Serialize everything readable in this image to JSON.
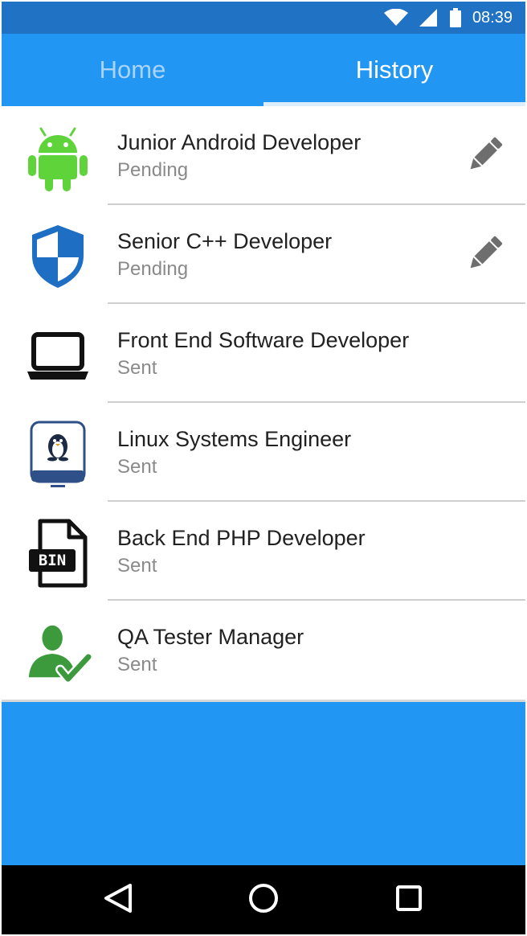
{
  "status_bar": {
    "time": "08:39",
    "icons": [
      "wifi-icon",
      "signal-icon",
      "battery-icon"
    ]
  },
  "tabs": [
    {
      "label": "Home",
      "selected": false
    },
    {
      "label": "History",
      "selected": true
    }
  ],
  "applications": [
    {
      "title": "Junior Android Developer",
      "status": "Pending",
      "icon": "android-icon",
      "editable": true
    },
    {
      "title": "Senior C++ Developer",
      "status": "Pending",
      "icon": "shield-icon",
      "editable": true
    },
    {
      "title": "Front End Software Developer",
      "status": "Sent",
      "icon": "laptop-icon",
      "editable": false
    },
    {
      "title": "Linux Systems Engineer",
      "status": "Sent",
      "icon": "linux-tux-icon",
      "editable": false
    },
    {
      "title": "Back End PHP Developer",
      "status": "Sent",
      "icon": "bin-file-icon",
      "editable": false
    },
    {
      "title": "QA Tester Manager",
      "status": "Sent",
      "icon": "user-check-icon",
      "editable": false
    }
  ],
  "nav_bar": {
    "buttons": [
      "back-icon",
      "home-icon",
      "recents-icon"
    ]
  },
  "colors": {
    "primary": "#2196f3",
    "status_bar": "#1f72c4",
    "android_green": "#5fd33a",
    "shield_blue": "#1e6fc4",
    "qa_green": "#3c9a3c"
  }
}
